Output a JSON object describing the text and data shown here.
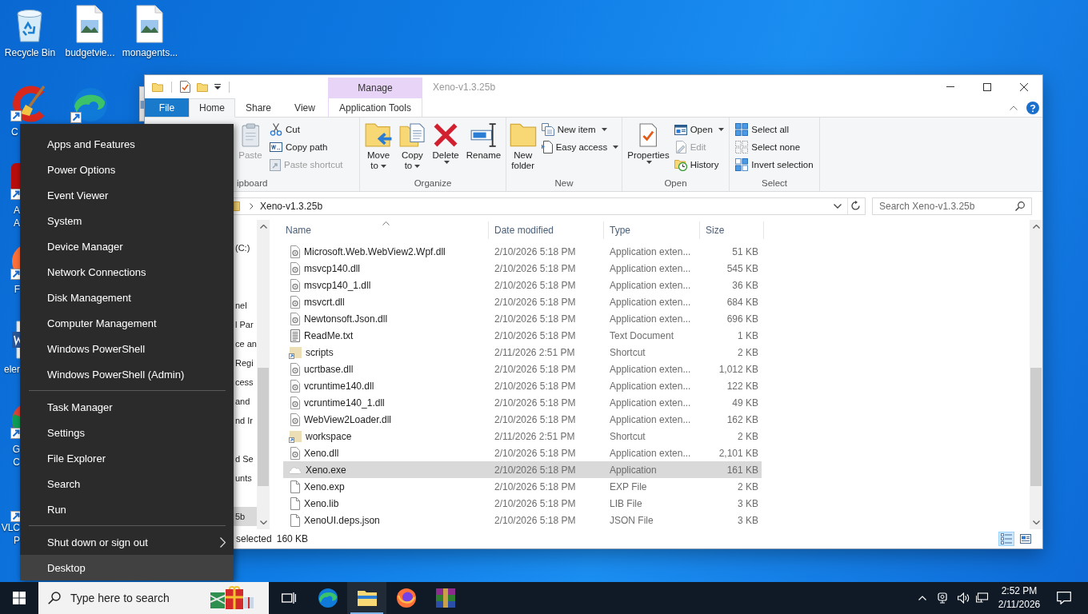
{
  "desktop": {
    "icons": [
      {
        "kind": "recycle-bin",
        "lines": [
          "Recycle Bin"
        ]
      },
      {
        "kind": "image-file",
        "lines": [
          "budgetvie..."
        ]
      },
      {
        "kind": "image-file",
        "lines": [
          "monagents..."
        ]
      },
      {
        "kind": "cleaner",
        "lines": [
          "C"
        ]
      },
      {
        "kind": "edge"
      },
      {
        "kind": "document"
      },
      {
        "kind": "red-app",
        "lines": [
          "A",
          "A"
        ]
      },
      {
        "kind": "firefox",
        "lines": [
          "F"
        ]
      },
      {
        "kind": "word-document",
        "lines": [
          "eler"
        ]
      },
      {
        "kind": "chrome",
        "lines": [
          "G",
          "C"
        ]
      },
      {
        "kind": "vlc",
        "lines": [
          "VLC",
          "P"
        ]
      }
    ]
  },
  "explorer": {
    "title": "Xeno-v1.3.25b",
    "context_group": "Manage",
    "tabs": [
      {
        "label": "File",
        "kind": "file",
        "selected": false
      },
      {
        "label": "Home",
        "kind": "tab",
        "selected": true
      },
      {
        "label": "Share",
        "kind": "tab",
        "selected": false
      },
      {
        "label": "View",
        "kind": "tab",
        "selected": false
      },
      {
        "label": "Application Tools",
        "kind": "contextual",
        "selected": false
      }
    ],
    "ribbon": [
      {
        "label": "ipboard",
        "commands": [
          {
            "label": "Paste",
            "kind": "large",
            "disabled": true,
            "dropdown": false
          },
          {
            "label": "Cut",
            "kind": "small",
            "disabled": false,
            "dropdown": false
          },
          {
            "label": "Copy path",
            "kind": "small",
            "disabled": false,
            "dropdown": false
          },
          {
            "label": "Paste shortcut",
            "kind": "small",
            "disabled": true,
            "dropdown": false
          }
        ]
      },
      {
        "label": "Organize",
        "commands": [
          {
            "label": "Move to",
            "kind": "large",
            "disabled": false,
            "dropdown": true
          },
          {
            "label": "Copy to",
            "kind": "large",
            "disabled": false,
            "dropdown": true
          },
          {
            "label": "Delete",
            "kind": "large",
            "disabled": false,
            "dropdown": true
          },
          {
            "label": "Rename",
            "kind": "large",
            "disabled": false,
            "dropdown": false
          }
        ]
      },
      {
        "label": "New",
        "commands": [
          {
            "label": "New folder",
            "kind": "large",
            "disabled": false,
            "dropdown": false
          },
          {
            "label": "New item",
            "kind": "small",
            "disabled": false,
            "dropdown": true
          },
          {
            "label": "Easy access",
            "kind": "small",
            "disabled": false,
            "dropdown": true
          }
        ]
      },
      {
        "label": "Open",
        "commands": [
          {
            "label": "Properties",
            "kind": "large",
            "disabled": false,
            "dropdown": true
          },
          {
            "label": "Open",
            "kind": "small",
            "disabled": false,
            "dropdown": true
          },
          {
            "label": "Edit",
            "kind": "small",
            "disabled": true,
            "dropdown": false
          },
          {
            "label": "History",
            "kind": "small",
            "disabled": false,
            "dropdown": false
          }
        ]
      },
      {
        "label": "Select",
        "commands": [
          {
            "label": "Select all",
            "kind": "small",
            "disabled": false,
            "dropdown": false
          },
          {
            "label": "Select none",
            "kind": "small",
            "disabled": false,
            "dropdown": false
          },
          {
            "label": "Invert selection",
            "kind": "small",
            "disabled": false,
            "dropdown": false
          }
        ]
      }
    ],
    "address": {
      "path": [
        "Xeno-v1.3.25b"
      ]
    },
    "search": {
      "placeholder": "Search Xeno-v1.3.25b"
    },
    "navigation": [
      {
        "label": "(C:)",
        "selected": false
      },
      {
        "label": "nel",
        "selected": false
      },
      {
        "label": "l Par",
        "selected": false
      },
      {
        "label": "ce an",
        "selected": false
      },
      {
        "label": "Regi",
        "selected": false
      },
      {
        "label": "cess",
        "selected": false
      },
      {
        "label": "and",
        "selected": false
      },
      {
        "label": "nd Ir",
        "selected": false
      },
      {
        "label": "d Se",
        "selected": false
      },
      {
        "label": "unts",
        "selected": false
      },
      {
        "label": "5b",
        "selected": true
      }
    ],
    "columns": [
      {
        "label": "Name",
        "sorted": true
      },
      {
        "label": "Date modified",
        "sorted": false
      },
      {
        "label": "Type",
        "sorted": false
      },
      {
        "label": "Size",
        "sorted": false
      }
    ],
    "files": [
      {
        "name": "Microsoft.Web.WebView2.Wpf.dll",
        "date": "2/10/2026 5:18 PM",
        "type": "Application exten...",
        "size": "51 KB",
        "kind": "library",
        "selected": false
      },
      {
        "name": "msvcp140.dll",
        "date": "2/10/2026 5:18 PM",
        "type": "Application exten...",
        "size": "545 KB",
        "kind": "library",
        "selected": false
      },
      {
        "name": "msvcp140_1.dll",
        "date": "2/10/2026 5:18 PM",
        "type": "Application exten...",
        "size": "36 KB",
        "kind": "library",
        "selected": false
      },
      {
        "name": "msvcrt.dll",
        "date": "2/10/2026 5:18 PM",
        "type": "Application exten...",
        "size": "684 KB",
        "kind": "library",
        "selected": false
      },
      {
        "name": "Newtonsoft.Json.dll",
        "date": "2/10/2026 5:18 PM",
        "type": "Application exten...",
        "size": "696 KB",
        "kind": "library",
        "selected": false
      },
      {
        "name": "ReadMe.txt",
        "date": "2/10/2026 5:18 PM",
        "type": "Text Document",
        "size": "1 KB",
        "kind": "text",
        "selected": false
      },
      {
        "name": "scripts",
        "date": "2/11/2026 2:51 PM",
        "type": "Shortcut",
        "size": "2 KB",
        "kind": "folder-shortcut",
        "selected": false
      },
      {
        "name": "ucrtbase.dll",
        "date": "2/10/2026 5:18 PM",
        "type": "Application exten...",
        "size": "1,012 KB",
        "kind": "library",
        "selected": false
      },
      {
        "name": "vcruntime140.dll",
        "date": "2/10/2026 5:18 PM",
        "type": "Application exten...",
        "size": "122 KB",
        "kind": "library",
        "selected": false
      },
      {
        "name": "vcruntime140_1.dll",
        "date": "2/10/2026 5:18 PM",
        "type": "Application exten...",
        "size": "49 KB",
        "kind": "library",
        "selected": false
      },
      {
        "name": "WebView2Loader.dll",
        "date": "2/10/2026 5:18 PM",
        "type": "Application exten...",
        "size": "162 KB",
        "kind": "library",
        "selected": false
      },
      {
        "name": "workspace",
        "date": "2/11/2026 2:51 PM",
        "type": "Shortcut",
        "size": "2 KB",
        "kind": "folder-shortcut",
        "selected": false
      },
      {
        "name": "Xeno.dll",
        "date": "2/10/2026 5:18 PM",
        "type": "Application exten...",
        "size": "2,101 KB",
        "kind": "library",
        "selected": false
      },
      {
        "name": "Xeno.exe",
        "date": "2/10/2026 5:18 PM",
        "type": "Application",
        "size": "161 KB",
        "kind": "application",
        "selected": true
      },
      {
        "name": "Xeno.exp",
        "date": "2/10/2026 5:18 PM",
        "type": "EXP File",
        "size": "2 KB",
        "kind": "file",
        "selected": false
      },
      {
        "name": "Xeno.lib",
        "date": "2/10/2026 5:18 PM",
        "type": "LIB File",
        "size": "3 KB",
        "kind": "file",
        "selected": false
      },
      {
        "name": "XenoUI.deps.json",
        "date": "2/10/2026 5:18 PM",
        "type": "JSON File",
        "size": "3 KB",
        "kind": "file",
        "selected": false
      }
    ],
    "status_bar": {
      "selection": "selected",
      "size": "160 KB"
    },
    "views": [
      {
        "kind": "details",
        "selected": true
      },
      {
        "kind": "large-icons",
        "selected": false
      }
    ]
  },
  "context_menu": {
    "sections": [
      [
        {
          "label": "Apps and Features",
          "submenu": false,
          "selected": false
        },
        {
          "label": "Power Options",
          "submenu": false,
          "selected": false
        },
        {
          "label": "Event Viewer",
          "submenu": false,
          "selected": false
        },
        {
          "label": "System",
          "submenu": false,
          "selected": false
        },
        {
          "label": "Device Manager",
          "submenu": false,
          "selected": false
        },
        {
          "label": "Network Connections",
          "submenu": false,
          "selected": false
        },
        {
          "label": "Disk Management",
          "submenu": false,
          "selected": false
        },
        {
          "label": "Computer Management",
          "submenu": false,
          "selected": false
        },
        {
          "label": "Windows PowerShell",
          "submenu": false,
          "selected": false
        },
        {
          "label": "Windows PowerShell (Admin)",
          "submenu": false,
          "selected": false
        }
      ],
      [
        {
          "label": "Task Manager",
          "submenu": false,
          "selected": false
        },
        {
          "label": "Settings",
          "submenu": false,
          "selected": false
        },
        {
          "label": "File Explorer",
          "submenu": false,
          "selected": false
        },
        {
          "label": "Search",
          "submenu": false,
          "selected": false
        },
        {
          "label": "Run",
          "submenu": false,
          "selected": false
        }
      ],
      [
        {
          "label": "Shut down or sign out",
          "submenu": true,
          "selected": false
        },
        {
          "label": "Desktop",
          "submenu": false,
          "selected": true
        }
      ]
    ]
  },
  "taskbar": {
    "search": {
      "placeholder": "Type here to search"
    },
    "apps": [
      {
        "kind": "task-view",
        "running": false
      },
      {
        "kind": "edge",
        "running": false
      },
      {
        "kind": "explorer",
        "running": true
      },
      {
        "kind": "firefox",
        "running": false
      },
      {
        "kind": "archive",
        "running": false
      }
    ],
    "time": "2:52 PM",
    "date": "2/11/2026"
  }
}
